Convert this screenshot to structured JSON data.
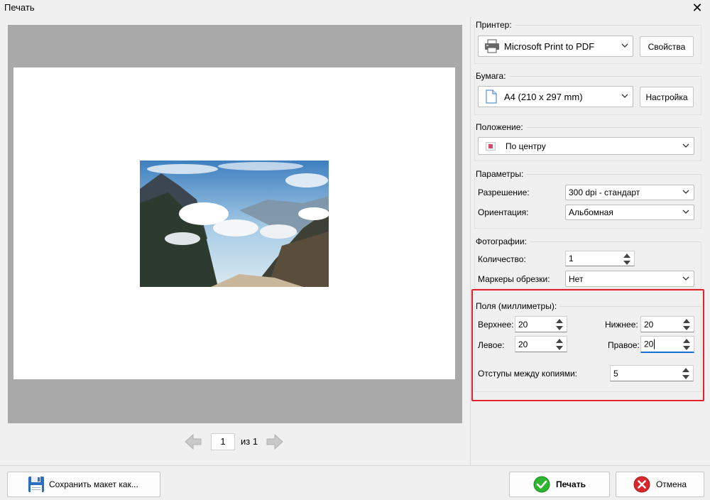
{
  "window": {
    "title": "Печать"
  },
  "pager": {
    "page": "1",
    "of_text": "из 1"
  },
  "printer": {
    "label": "Принтер:",
    "value": "Microsoft Print to PDF",
    "props_button": "Свойства"
  },
  "paper": {
    "label": "Бумага:",
    "value": "A4 (210 x 297 mm)",
    "setup_button": "Настройка"
  },
  "position": {
    "label": "Положение:",
    "value": "По центру"
  },
  "params": {
    "label": "Параметры:",
    "resolution_label": "Разрешение:",
    "resolution_value": "300 dpi - стандарт",
    "orientation_label": "Ориентация:",
    "orientation_value": "Альбомная"
  },
  "photos": {
    "label": "Фотографии:",
    "count_label": "Количество:",
    "count_value": "1",
    "crop_label": "Маркеры обрезки:",
    "crop_value": "Нет"
  },
  "margins": {
    "label": "Поля (миллиметры):",
    "top_label": "Верхнее:",
    "top_value": "20",
    "bottom_label": "Нижнее:",
    "bottom_value": "20",
    "left_label": "Левое:",
    "left_value": "20",
    "right_label": "Правое:",
    "right_value": "20",
    "gap_label": "Отступы между копиями:",
    "gap_value": "5"
  },
  "footer": {
    "save_button": "Сохранить макет как...",
    "print_button": "Печать",
    "cancel_button": "Отмена"
  },
  "colors": {
    "highlight": "#e3202b",
    "preview_bg": "#a9a9a9",
    "print_icon": "#2fb52f",
    "cancel_icon": "#d9272e"
  }
}
